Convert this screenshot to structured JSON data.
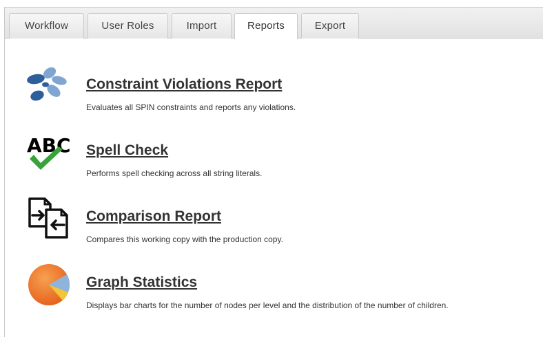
{
  "tabs": [
    {
      "label": "Workflow"
    },
    {
      "label": "User Roles"
    },
    {
      "label": "Import"
    },
    {
      "label": "Reports"
    },
    {
      "label": "Export"
    }
  ],
  "active_tab": "Reports",
  "reports": [
    {
      "title": "Constraint Violations Report",
      "description": "Evaluates all SPIN constraints and reports any violations.",
      "icon": "spin-logo-icon"
    },
    {
      "title": "Spell Check",
      "description": "Performs spell checking across all string literals.",
      "icon": "abc-checkmark-icon",
      "icon_text": "ABC"
    },
    {
      "title": "Comparison Report",
      "description": "Compares this working copy with the production copy.",
      "icon": "compare-documents-icon"
    },
    {
      "title": "Graph Statistics",
      "description": "Displays bar charts for the number of nodes per level and the distribution of the number of children.",
      "icon": "pie-chart-icon"
    }
  ],
  "colors": {
    "spin_blue_dark": "#2e5e9c",
    "spin_blue_light": "#7fa6d3",
    "check_green": "#3aa23a",
    "pie_orange": "#f07a1e",
    "pie_blue": "#8fb4dc",
    "pie_yellow": "#f3c53a"
  }
}
